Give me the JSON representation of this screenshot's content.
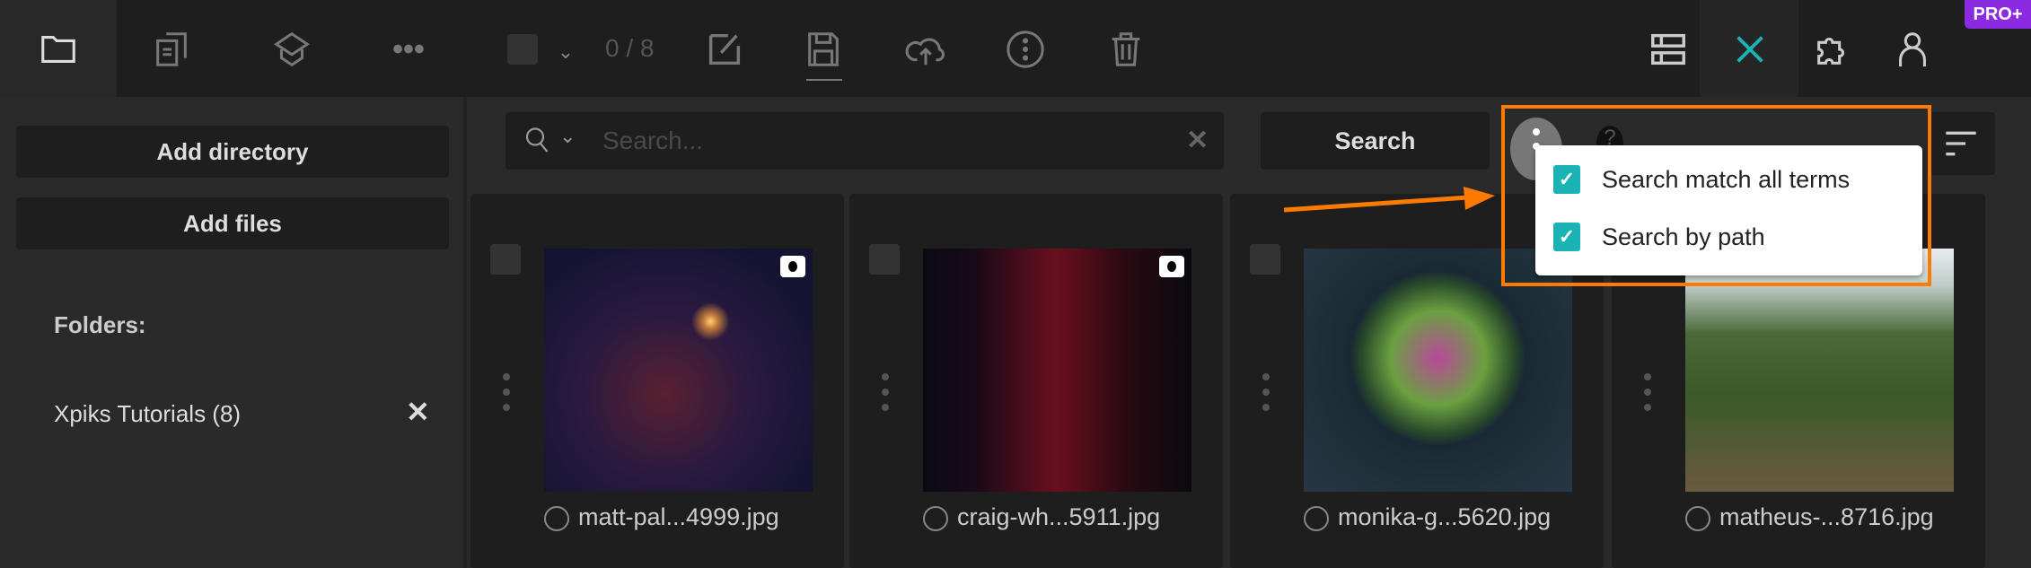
{
  "toolbar": {
    "counter": "0 / 8",
    "pro_badge": "PRO+",
    "icons": [
      "folder-icon",
      "files-icon",
      "graduation-cap-icon",
      "more-icon",
      "checkbox-icon",
      "chevron-down-icon",
      "edit-icon",
      "save-icon",
      "upload-cloud-icon",
      "info-icon",
      "trash-icon",
      "list-view-icon",
      "close-icon",
      "plugin-icon",
      "user-icon"
    ]
  },
  "sidebar": {
    "add_directory": "Add directory",
    "add_files": "Add files",
    "folders_label": "Folders:",
    "folders": [
      {
        "name": "Xpiks Tutorials (8)"
      }
    ]
  },
  "search": {
    "placeholder": "Search...",
    "value": "",
    "button": "Search",
    "help": "?"
  },
  "popup": {
    "items": [
      {
        "label": "Search match all terms",
        "checked": true
      },
      {
        "label": "Search by path",
        "checked": true
      }
    ]
  },
  "files": [
    {
      "name": "matt-pal...4999.jpg"
    },
    {
      "name": "craig-wh...5911.jpg"
    },
    {
      "name": "monika-g...5620.jpg"
    },
    {
      "name": "matheus-...8716.jpg"
    }
  ],
  "colors": {
    "accent": "#1ab3b8",
    "highlight": "#ff7a00",
    "pro": "#8a2be2"
  }
}
